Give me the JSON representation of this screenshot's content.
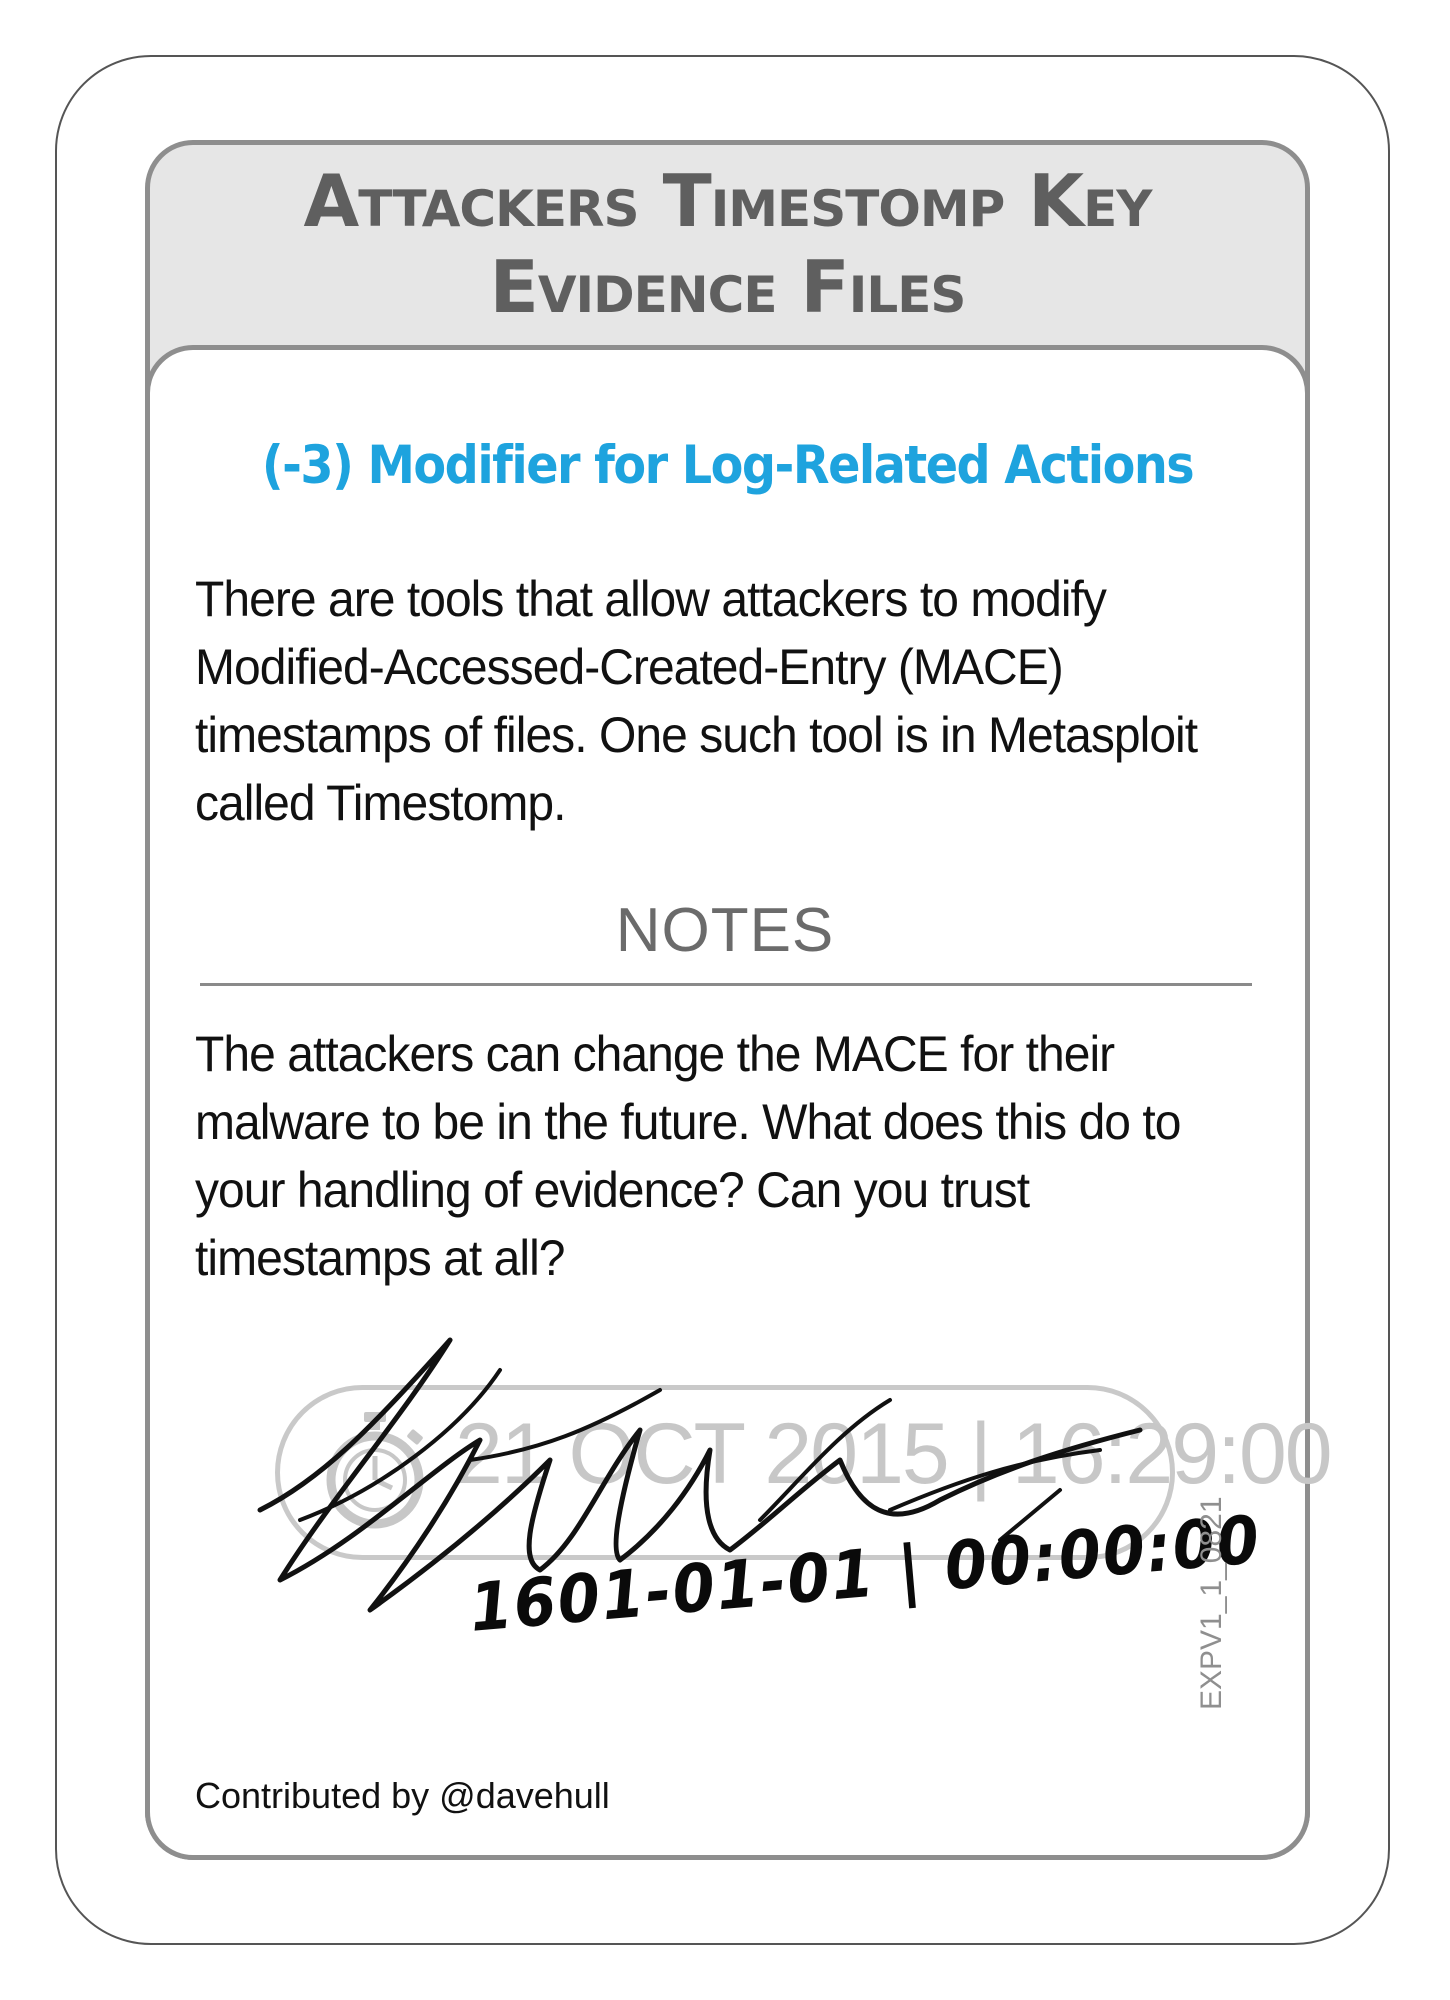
{
  "card": {
    "title_line1": "Attackers Timestomp Key",
    "title_line2": "Evidence Files",
    "modifier": "(-3) Modifier for Log-Related Actions",
    "description": "There are tools that allow attackers to modify Modified-Accessed-Created-Entry (MACE) timestamps of files. One such tool is in Metasploit called Timestomp.",
    "notes_label": "NOTES",
    "notes_text": "The attackers can change the MACE for their malware to be in the future. What does this do to your handling of evidence? Can you trust timestamps at all?",
    "timestamp_original": "21 OCT 2015 | 16:29:00",
    "timestamp_icon": "stopwatch-icon",
    "timestamp_handwritten": "1601-01-01 | 00:00:00",
    "contributed_by": "Contributed by @davehull",
    "card_code": "EXPV1_1_0821"
  },
  "colors": {
    "title": "#5f5f5f",
    "modifier": "#1ea3de",
    "panel_border": "#8e8e8e",
    "header_bg": "#e6e6e6",
    "faded_timestamp": "#c7c7c7"
  }
}
